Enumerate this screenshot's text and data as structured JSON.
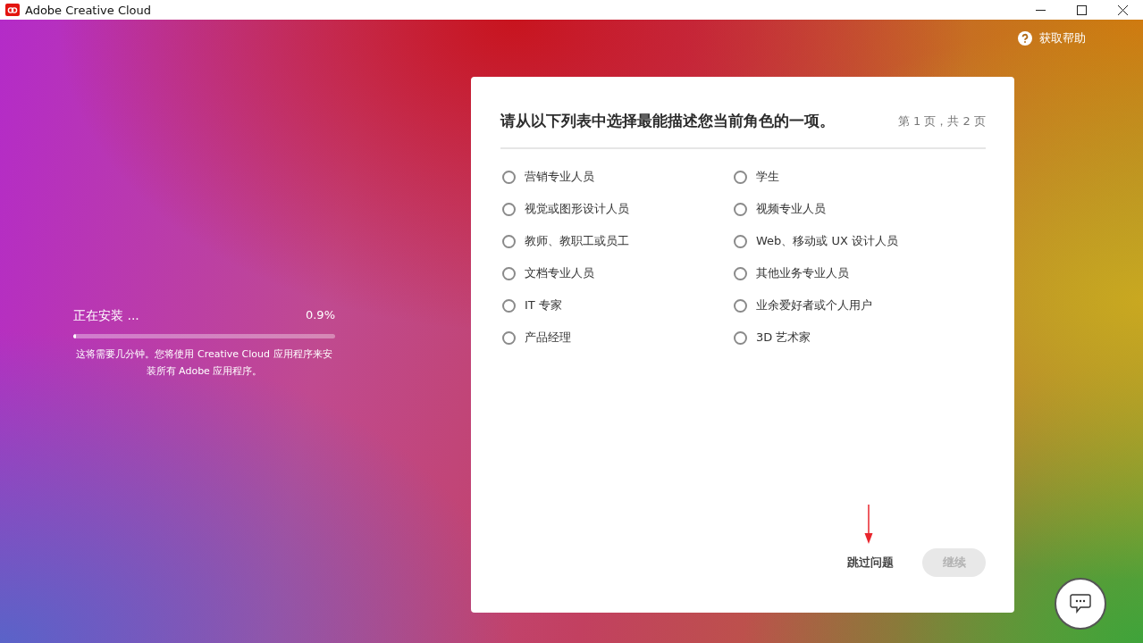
{
  "window": {
    "title": "Adobe Creative Cloud"
  },
  "help": {
    "label": "获取帮助"
  },
  "install": {
    "status": "正在安装 ...",
    "percent": "0.9%",
    "level": 0.009,
    "note": "这将需要几分钟。您将使用 Creative Cloud 应用程序来安装所有 Adobe 应用程序。"
  },
  "survey": {
    "question": "请从以下列表中选择最能描述您当前角色的一项。",
    "page": "第 1 页，共 2 页",
    "columns": [
      [
        {
          "label": "营销专业人员",
          "selected": false
        },
        {
          "label": "视觉或图形设计人员",
          "selected": false
        },
        {
          "label": "教师、教职工或员工",
          "selected": false
        },
        {
          "label": "文档专业人员",
          "selected": false
        },
        {
          "label": "IT 专家",
          "selected": false
        },
        {
          "label": "产品经理",
          "selected": false
        }
      ],
      [
        {
          "label": "学生",
          "selected": false
        },
        {
          "label": "视频专业人员",
          "selected": false
        },
        {
          "label": "Web、移动或 UX 设计人员",
          "selected": false
        },
        {
          "label": "其他业务专业人员",
          "selected": false
        },
        {
          "label": "业余爱好者或个人用户",
          "selected": false
        },
        {
          "label": "3D 艺术家",
          "selected": false
        }
      ]
    ],
    "skip": "跳过问题",
    "continue": {
      "label": "继续",
      "disabled": true
    }
  },
  "annotations": [
    {
      "kind": "arrow"
    }
  ]
}
